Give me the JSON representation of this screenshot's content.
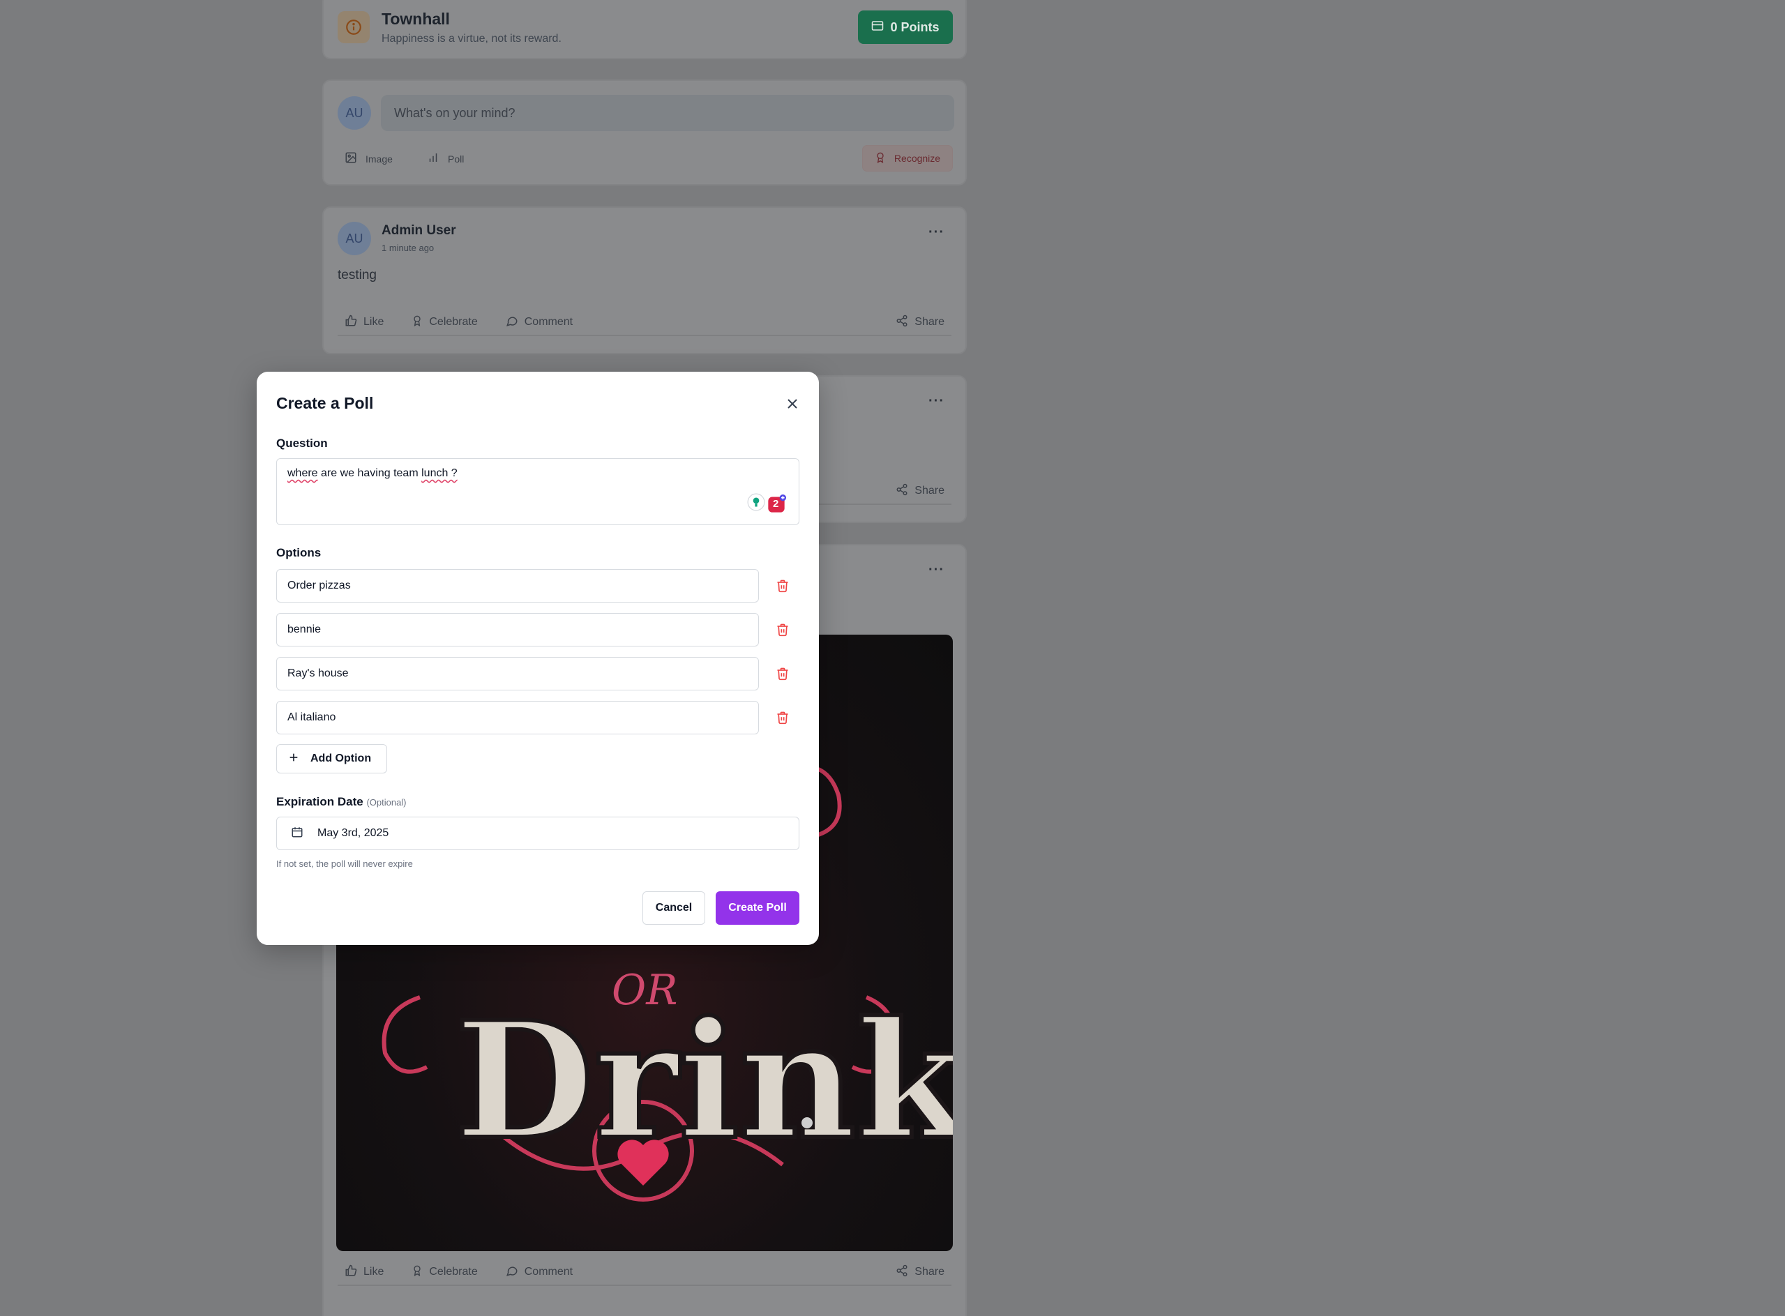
{
  "header": {
    "title": "Townhall",
    "subtitle": "Happiness is a virtue, not its reward.",
    "points_label": "0 Points"
  },
  "composer": {
    "avatar_initials": "AU",
    "placeholder": "What's on your mind?",
    "image_label": "Image",
    "poll_label": "Poll",
    "recognize_label": "Recognize"
  },
  "posts": [
    {
      "author": "Admin User",
      "avatar_initials": "AU",
      "time": "1 minute ago",
      "body": "testing",
      "actions": {
        "like": "Like",
        "celebrate": "Celebrate",
        "comment": "Comment",
        "share": "Share"
      }
    },
    {
      "actions": {
        "share": "Share"
      }
    },
    {
      "actions": {
        "like": "Like",
        "celebrate": "Celebrate",
        "comment": "Comment",
        "share": "Share"
      }
    }
  ],
  "modal": {
    "title": "Create a Poll",
    "question_label": "Question",
    "question_value": "where are we having team lunch ?",
    "question_words": [
      "where",
      " are we having team ",
      "lunch ?"
    ],
    "extension_badge_count": "2",
    "options_label": "Options",
    "options": [
      "Order pizzas",
      "bennie",
      "Ray's house",
      "Al italiano"
    ],
    "add_option_label": "Add Option",
    "expiration_label": "Expiration Date",
    "expiration_optional": "(Optional)",
    "expiration_value": "May 3rd, 2025",
    "expiration_hint": "If not set, the poll will never expire",
    "cancel_label": "Cancel",
    "create_label": "Create Poll"
  },
  "colors": {
    "overlay": "#7b7c7e",
    "points_green": "#1a6f4d",
    "create_purple": "#9333ea",
    "trash_red": "#ef4444"
  },
  "image_overlay_text": [
    "OR",
    "Drink"
  ]
}
